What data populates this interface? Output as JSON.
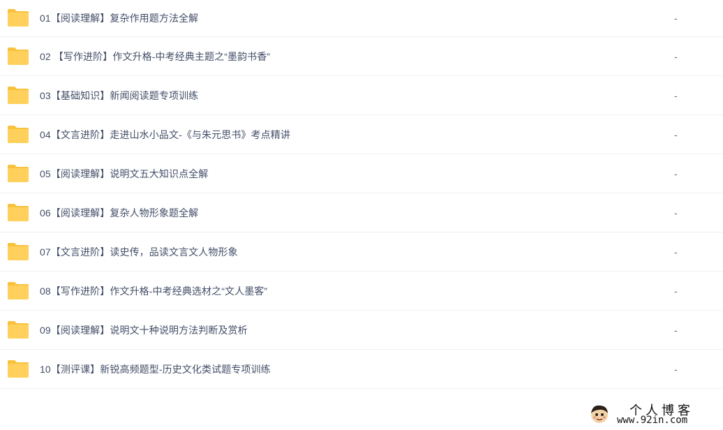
{
  "files": [
    {
      "name": "01【阅读理解】复杂作用题方法全解",
      "size": "-",
      "icon": "folder-icon"
    },
    {
      "name": "02 【写作进阶】作文升格-中考经典主题之“墨韵书香”",
      "size": "-",
      "icon": "folder-icon"
    },
    {
      "name": "03【基础知识】新闻阅读题专项训练",
      "size": "-",
      "icon": "folder-icon"
    },
    {
      "name": "04【文言进阶】走进山水小品文-《与朱元思书》考点精讲",
      "size": "-",
      "icon": "folder-icon"
    },
    {
      "name": "05【阅读理解】说明文五大知识点全解",
      "size": "-",
      "icon": "folder-icon"
    },
    {
      "name": "06【阅读理解】复杂人物形象题全解",
      "size": "-",
      "icon": "folder-icon"
    },
    {
      "name": "07【文言进阶】读史传，品读文言文人物形象",
      "size": "-",
      "icon": "folder-icon"
    },
    {
      "name": "08【写作进阶】作文升格-中考经典选材之“文人墨客”",
      "size": "-",
      "icon": "folder-icon"
    },
    {
      "name": "09【阅读理解】说明文十种说明方法判断及赏析",
      "size": "-",
      "icon": "folder-icon"
    },
    {
      "name": "10【测评课】新锐高频题型-历史文化类试题专项训练",
      "size": "-",
      "icon": "folder-icon"
    }
  ],
  "watermark": {
    "title": "个人博客",
    "url": "www.92in.com"
  },
  "colors": {
    "folder": "#ffd15c",
    "folder_tab": "#f8c23e",
    "text": "#424e67",
    "divider": "#eef0f4"
  }
}
